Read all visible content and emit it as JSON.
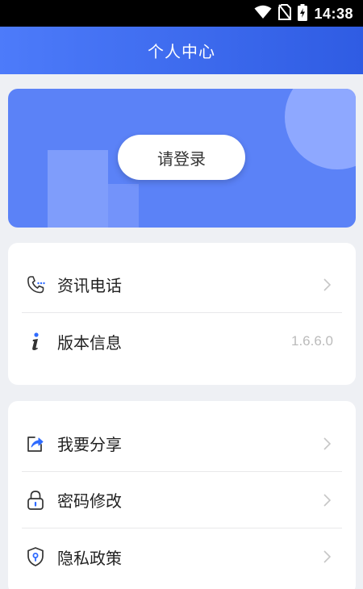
{
  "status_bar": {
    "time": "14:38",
    "icons": [
      "wifi-icon",
      "no-sim-icon",
      "battery-charging-icon"
    ]
  },
  "header": {
    "title": "个人中心"
  },
  "banner": {
    "login_label": "请登录"
  },
  "menu_group_1": [
    {
      "label": "资讯电话",
      "icon": "phone-icon",
      "value": null,
      "has_chevron": true
    },
    {
      "label": "版本信息",
      "icon": "info-icon",
      "value": "1.6.6.0",
      "has_chevron": false
    }
  ],
  "menu_group_2": [
    {
      "label": "我要分享",
      "icon": "share-icon",
      "has_chevron": true
    },
    {
      "label": "密码修改",
      "icon": "lock-icon",
      "has_chevron": true
    },
    {
      "label": "隐私政策",
      "icon": "shield-icon",
      "has_chevron": true
    }
  ],
  "colors": {
    "header_gradient_start": "#4d7bfa",
    "header_gradient_end": "#2f5ce3",
    "banner": "#5b82f7",
    "icon_accent": "#2f6bff"
  }
}
